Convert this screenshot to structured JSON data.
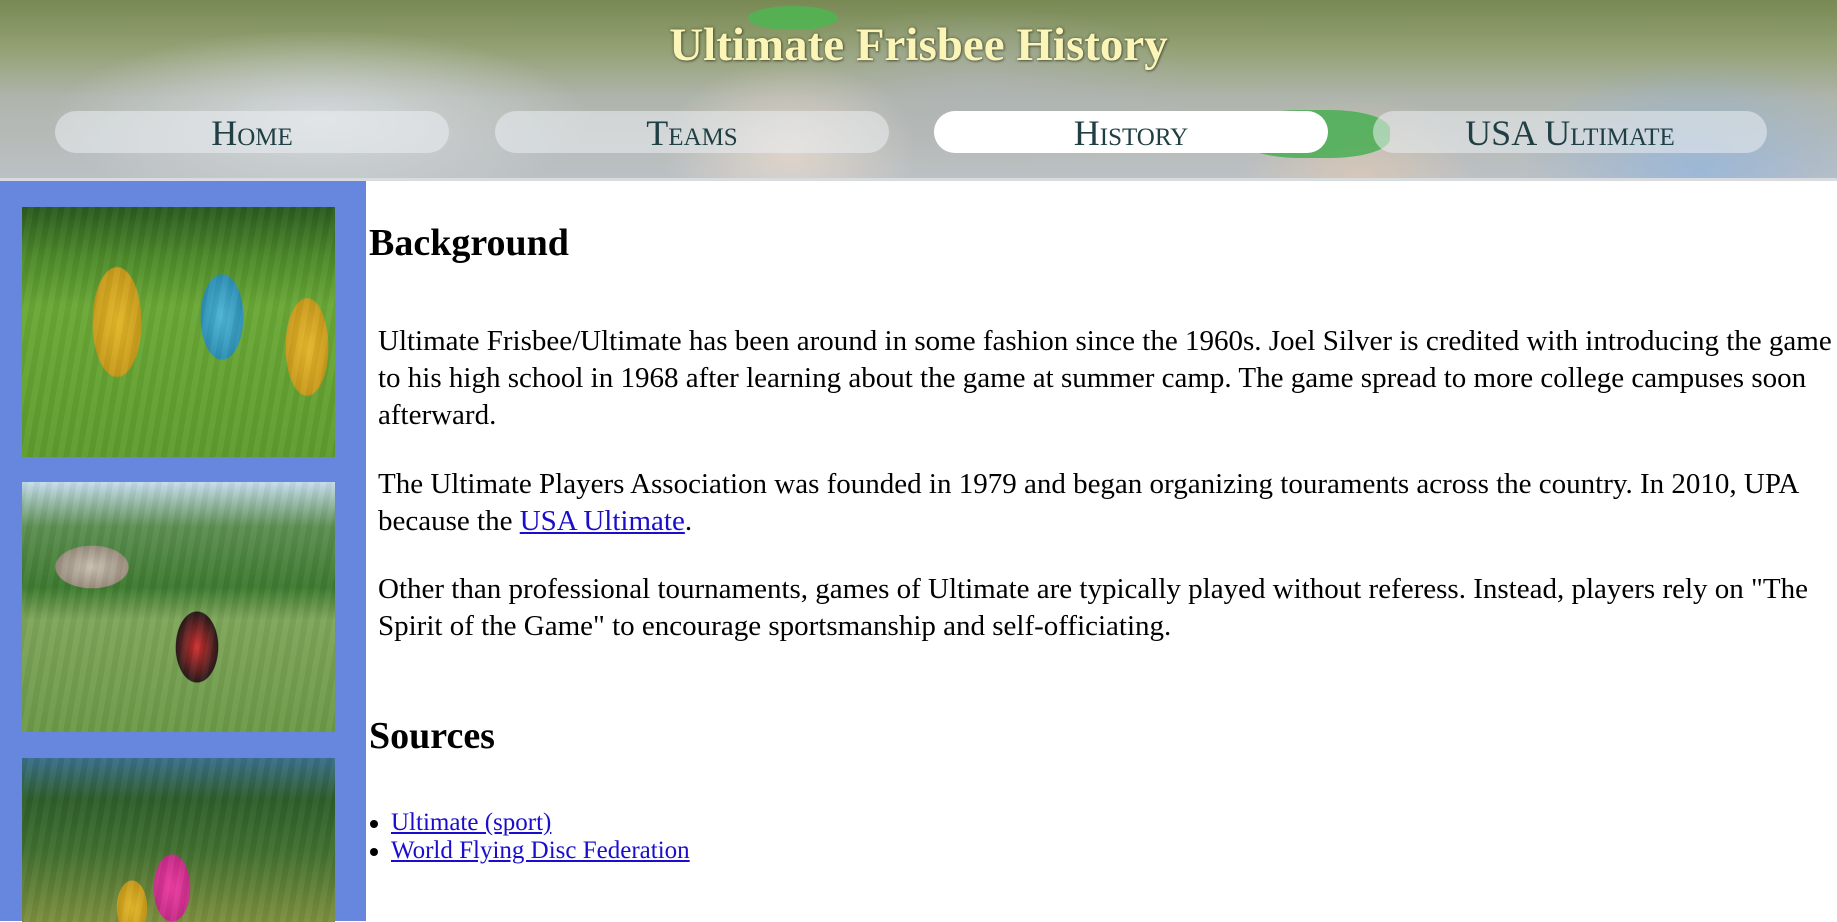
{
  "header": {
    "title": "Ultimate Frisbee History",
    "nav": [
      {
        "label": "Home",
        "active": false
      },
      {
        "label": "Teams",
        "active": false
      },
      {
        "label": "History",
        "active": true
      },
      {
        "label": "USA Ultimate",
        "active": false
      }
    ]
  },
  "sidebar": {
    "photos": [
      "ultimate-game-photo",
      "ultimate-field-photo",
      "ultimate-catch-photo"
    ]
  },
  "main": {
    "background_heading": "Background",
    "paragraph1": "Ultimate Frisbee/Ultimate has been around in some fashion since the 1960s. Joel Silver is credited with introducing the game to his high school in 1968 after learning about the game at summer camp. The game spread to more college campuses soon afterward.",
    "paragraph2_before": "The Ultimate Players Association was founded in 1979 and began organizing touraments across the country. In 2010, UPA because the ",
    "paragraph2_link": "USA Ultimate",
    "paragraph2_after": ".",
    "paragraph3": "Other than professional tournaments, games of Ultimate are typically played without referess. Instead, players rely on \"The Spirit of the Game\" to encourage sportsmanship and self-officiating.",
    "sources_heading": "Sources",
    "sources": [
      "Ultimate (sport)",
      "World Flying Disc Federation"
    ]
  },
  "colors": {
    "sidebar": "#6786dd",
    "title": "#fbf6b8",
    "nav_text": "#1f3f44",
    "link": "#1a0dcc"
  }
}
